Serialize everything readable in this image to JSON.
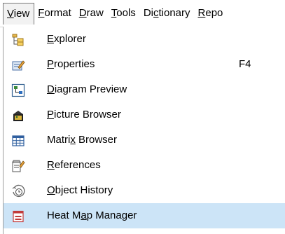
{
  "menubar": {
    "items": [
      {
        "pre": "",
        "mn": "V",
        "post": "iew"
      },
      {
        "pre": "",
        "mn": "F",
        "post": "ormat"
      },
      {
        "pre": "",
        "mn": "D",
        "post": "raw"
      },
      {
        "pre": "",
        "mn": "T",
        "post": "ools"
      },
      {
        "pre": "Di",
        "mn": "c",
        "post": "tionary"
      },
      {
        "pre": "",
        "mn": "R",
        "post": "epo"
      }
    ]
  },
  "menu": {
    "items": [
      {
        "pre": "",
        "mn": "E",
        "post": "xplorer",
        "shortcut": "",
        "icon": "folder-tree-icon"
      },
      {
        "pre": "",
        "mn": "P",
        "post": "roperties",
        "shortcut": "F4",
        "icon": "properties-icon"
      },
      {
        "pre": "",
        "mn": "D",
        "post": "iagram Preview",
        "shortcut": "",
        "icon": "diagram-preview-icon"
      },
      {
        "pre": "",
        "mn": "P",
        "post": "icture Browser",
        "shortcut": "",
        "icon": "picture-browser-icon"
      },
      {
        "pre": "Matri",
        "mn": "x",
        "post": " Browser",
        "shortcut": "",
        "icon": "matrix-browser-icon"
      },
      {
        "pre": "",
        "mn": "R",
        "post": "eferences",
        "shortcut": "",
        "icon": "references-icon"
      },
      {
        "pre": "",
        "mn": "O",
        "post": "bject History",
        "shortcut": "",
        "icon": "object-history-icon"
      },
      {
        "pre": "Heat M",
        "mn": "a",
        "post": "p Manager",
        "shortcut": "",
        "icon": "heat-map-icon"
      }
    ],
    "highlight_color": "#cce4f7"
  }
}
